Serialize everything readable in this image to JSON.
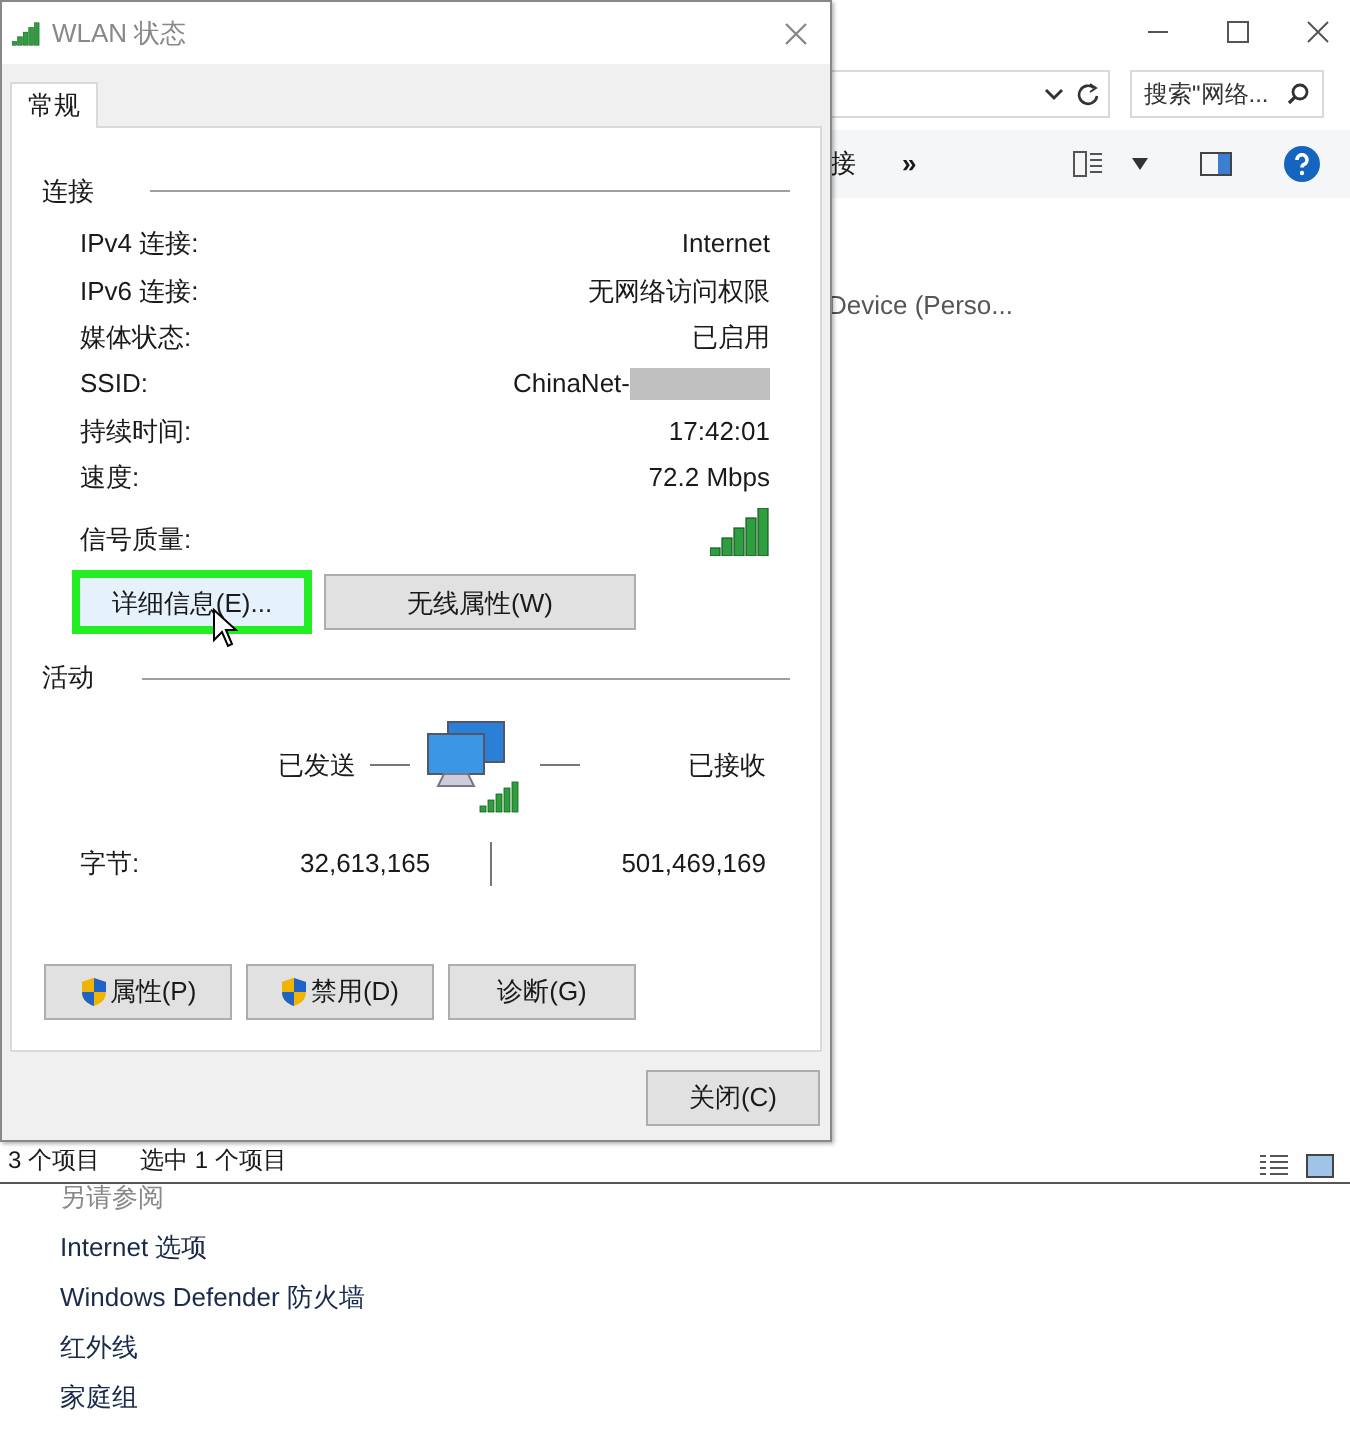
{
  "explorer": {
    "search": {
      "placeholder": "搜索\"网络..."
    },
    "toolbar": {
      "items": [
        "接",
        "»"
      ]
    },
    "content": [
      "Device (Perso..."
    ],
    "status_bar": {
      "count": "3 个项目",
      "selection": "选中 1 个项目"
    }
  },
  "see_also": {
    "title": "另请参阅",
    "links": [
      "Internet 选项",
      "Windows Defender 防火墙",
      "红外线",
      "家庭组"
    ]
  },
  "dialog": {
    "title": "WLAN 状态",
    "tabs": [
      {
        "label": "常规",
        "selected": true
      }
    ],
    "connection": {
      "title": "连接",
      "rows": [
        {
          "label": "IPv4 连接:",
          "value": "Internet",
          "redacted": false
        },
        {
          "label": "IPv6 连接:",
          "value": "无网络访问权限",
          "redacted": false
        },
        {
          "label": "媒体状态:",
          "value": "已启用",
          "redacted": false
        },
        {
          "label": "SSID:",
          "value": "ChinaNet-",
          "redacted": true
        },
        {
          "label": "持续时间:",
          "value": "17:42:01",
          "redacted": false
        },
        {
          "label": "速度:",
          "value": "72.2 Mbps",
          "redacted": false
        }
      ],
      "signal_label": "信号质量:",
      "buttons": [
        {
          "label": "详细信息(E)...",
          "highlighted": true
        },
        {
          "label": "无线属性(W)",
          "highlighted": false
        }
      ]
    },
    "activity": {
      "title": "活动",
      "sent_label": "已发送",
      "received_label": "已接收",
      "bytes_label": "字节:",
      "sent": "32,613,165",
      "received": "501,469,169"
    },
    "actions": [
      {
        "label": "属性(P)",
        "shield": true
      },
      {
        "label": "禁用(D)",
        "shield": true
      },
      {
        "label": "诊断(G)",
        "shield": false
      }
    ],
    "close_button": "关闭(C)"
  }
}
